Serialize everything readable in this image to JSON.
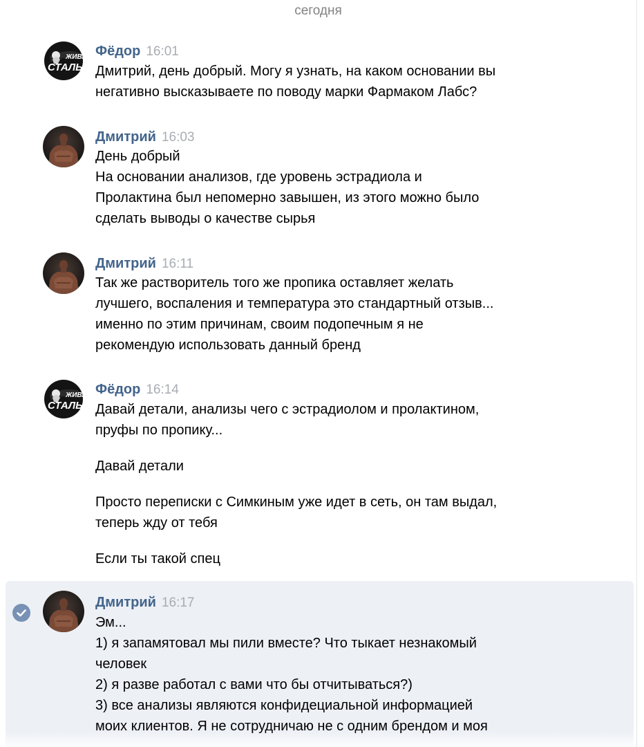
{
  "date_separator": "сегодня",
  "messages": [
    {
      "author": "Фёдор",
      "time": "16:01",
      "avatar": "zhivaya-stal-logo",
      "lines": [
        "Дмитрий, день добрый. Могу я узнать, на каком основании вы",
        "негативно высказываете по поводу марки Фармаком Лабс?"
      ]
    },
    {
      "author": "Дмитрий",
      "time": "16:03",
      "avatar": "bodybuilder-photo",
      "lines": [
        "День добрый",
        "На основании анализов, где уровень эстрадиола и",
        "Пролактина был непомерно завышен, из этого можно было",
        "сделать выводы о качестве сырья"
      ]
    },
    {
      "author": "Дмитрий",
      "time": "16:11",
      "avatar": "bodybuilder-photo",
      "lines": [
        "Так же растворитель того же пропика оставляет желать",
        "лучшего, воспаления и температура это стандартный отзыв...",
        "именно по этим причинам, своим подопечным я не",
        "рекомендую использовать данный бренд"
      ]
    },
    {
      "author": "Фёдор",
      "time": "16:14",
      "avatar": "zhivaya-stal-logo",
      "paragraphs": [
        [
          "Давай детали, анализы чего с эстрадиолом и пролактином,",
          "пруфы по пропику..."
        ],
        [
          "Давай детали"
        ],
        [
          "Просто переписки с Симкиным уже идет в сеть, он там выдал,",
          "теперь жду от тебя"
        ],
        [
          "Если ты такой спец"
        ]
      ]
    },
    {
      "author": "Дмитрий",
      "time": "16:17",
      "avatar": "bodybuilder-photo",
      "selected": true,
      "lines": [
        "Эм...",
        "1) я запамятовал мы пили вместе? Что тыкает незнакомый",
        "человек",
        "2) я разве работал с вами что бы отчитываться?)",
        "3) все анализы являются конфидециальной информацией",
        "моих клиентов. Я не сотрудничаю не с одним брендом и моя"
      ]
    }
  ],
  "avatar_logo_text": [
    "ЖИВАЯ",
    "СТАЛЬ"
  ],
  "colors": {
    "author": "#42648b",
    "time": "#a8adb3",
    "selected_bg": "#edf0f5",
    "check": "#7892b5"
  }
}
